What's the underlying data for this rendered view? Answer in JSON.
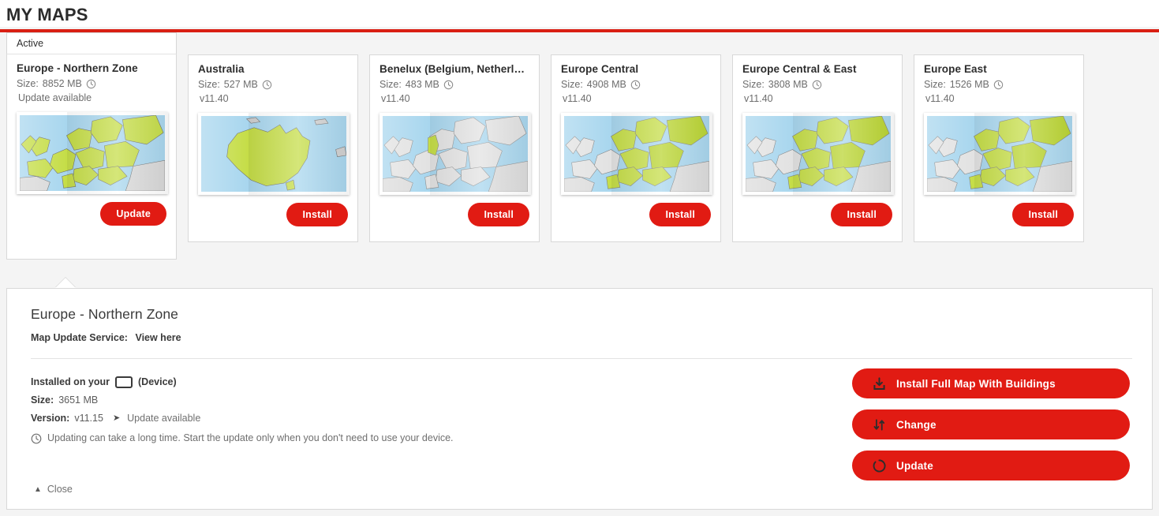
{
  "header": {
    "title": "MY MAPS",
    "accent_color": "#d91f13"
  },
  "tabs": {
    "active_label": "Active"
  },
  "cards": [
    {
      "name": "Europe - Northern Zone",
      "size_label": "Size:",
      "size": "8852 MB",
      "sub": "Update available",
      "button": "Update",
      "thumb": "europe-north",
      "clock_icon": "clock-icon"
    },
    {
      "name": "Australia",
      "size_label": "Size:",
      "size": "527 MB",
      "sub": "v11.40",
      "button": "Install",
      "thumb": "australia",
      "clock_icon": "clock-icon"
    },
    {
      "name": "Benelux (Belgium, Netherlan...",
      "size_label": "Size:",
      "size": "483 MB",
      "sub": "v11.40",
      "button": "Install",
      "thumb": "benelux",
      "clock_icon": "clock-icon"
    },
    {
      "name": "Europe Central",
      "size_label": "Size:",
      "size": "4908 MB",
      "sub": "v11.40",
      "button": "Install",
      "thumb": "europe-central",
      "clock_icon": "clock-icon"
    },
    {
      "name": "Europe Central & East",
      "size_label": "Size:",
      "size": "3808 MB",
      "sub": "v11.40",
      "button": "Install",
      "thumb": "europe-central-east",
      "clock_icon": "clock-icon"
    },
    {
      "name": "Europe East",
      "size_label": "Size:",
      "size": "1526 MB",
      "sub": "v11.40",
      "button": "Install",
      "thumb": "europe-east",
      "clock_icon": "clock-icon"
    }
  ],
  "detail": {
    "title": "Europe - Northern Zone",
    "service_label": "Map Update Service:",
    "service_link": "View here",
    "installed_prefix": "Installed on your",
    "installed_suffix": "(Device)",
    "size_label": "Size:",
    "size_value": "3651 MB",
    "version_label": "Version:",
    "version_value": "v11.15",
    "version_status": "Update available",
    "note": "Updating can take a long time. Start the update only when you don't need to use your device.",
    "close_label": "Close",
    "actions": [
      {
        "label": "Install Full Map With Buildings",
        "icon": "download-icon"
      },
      {
        "label": "Change",
        "icon": "swap-arrows-icon"
      },
      {
        "label": "Update",
        "icon": "refresh-icon"
      }
    ]
  }
}
